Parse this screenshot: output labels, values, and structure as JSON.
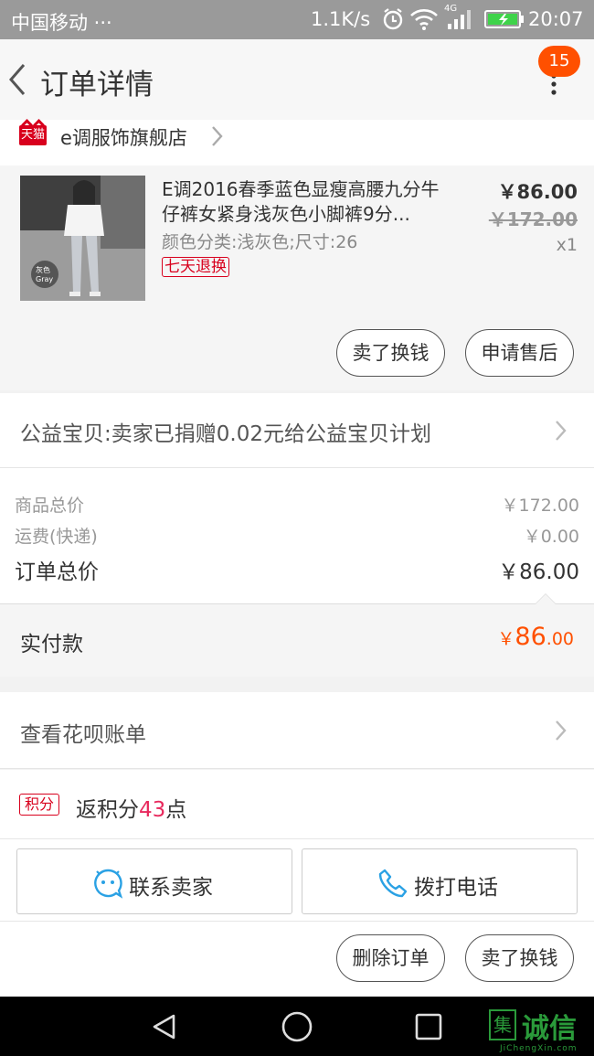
{
  "status_bar": {
    "carrier": "中国移动 ···",
    "speed": "1.1K/s",
    "network": "4G",
    "time": "20:07"
  },
  "header": {
    "title": "订单详情",
    "badge_count": "15"
  },
  "shop": {
    "logo_text": "天猫",
    "name": "e调服饰旗舰店"
  },
  "product": {
    "title": "E调2016春季蓝色显瘦高腰九分牛仔裤女紧身浅灰色小脚裤9分...",
    "sku": "颜色分类:浅灰色;尺寸:26",
    "tag": "七天退换",
    "price": "￥86.00",
    "original_price": "￥172.00",
    "quantity": "x1",
    "thumb_label_1": "灰色",
    "thumb_label_2": "Gray",
    "buttons": {
      "sell": "卖了换钱",
      "after_sale": "申请售后"
    }
  },
  "charity": {
    "text": "公益宝贝:卖家已捐赠0.02元给公益宝贝计划"
  },
  "summary": {
    "goods_total_label": "商品总价",
    "goods_total_value": "￥172.00",
    "shipping_label": "运费(快递)",
    "shipping_value": "￥0.00",
    "order_total_label": "订单总价",
    "order_total_value": "￥86.00"
  },
  "paid": {
    "label": "实付款",
    "currency": "￥",
    "integer": "86",
    "decimal": ".00"
  },
  "huabei": {
    "text": "查看花呗账单"
  },
  "points": {
    "tag": "积分",
    "prefix": "返积分",
    "value": "43",
    "suffix": "点"
  },
  "contact": {
    "seller": "联系卖家",
    "phone": "拨打电话"
  },
  "actions": {
    "delete": "删除订单",
    "sell": "卖了换钱"
  },
  "watermark": {
    "box": "集",
    "text": "诚信",
    "sub": "JiChengXin.com"
  },
  "colors": {
    "accent_orange": "#ff5000",
    "tmall_red": "#d8001d",
    "points_pink": "#e8295d",
    "link_blue": "#2aa1e4"
  }
}
